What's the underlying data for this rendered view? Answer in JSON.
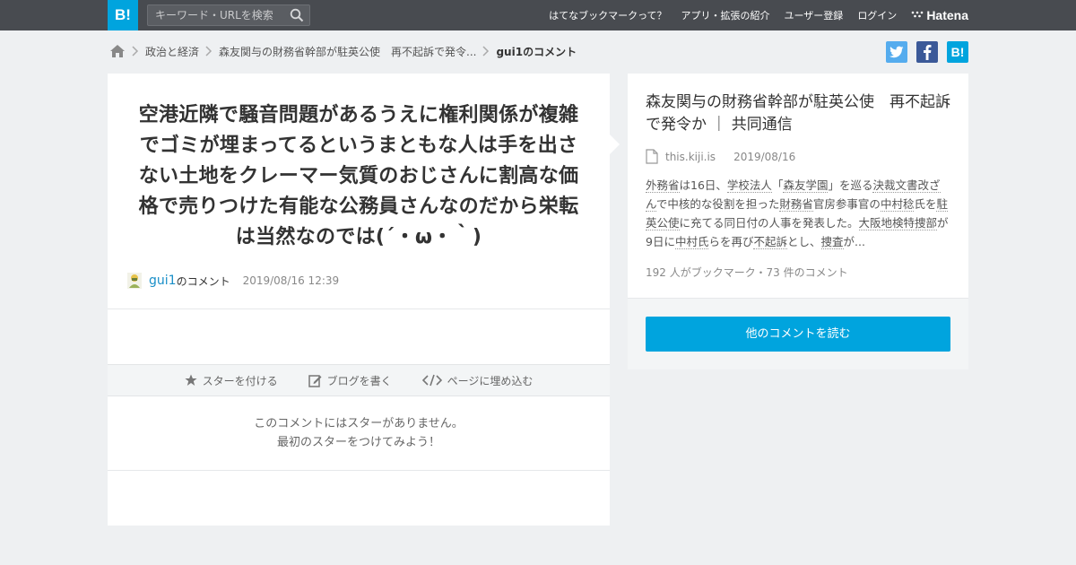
{
  "header": {
    "logo": "B!",
    "search_placeholder": "キーワード・URLを検索",
    "nav": [
      {
        "label": "はてなブックマークって？"
      },
      {
        "label": "アプリ・拡張の紹介"
      },
      {
        "label": "ユーザー登録"
      },
      {
        "label": "ログイン"
      }
    ],
    "brand": "Hatena"
  },
  "breadcrumb": {
    "items": [
      "政治と経済",
      "森友関与の財務省幹部が駐英公使　再不起訴で発令..."
    ],
    "current": "gui1のコメント"
  },
  "share": {
    "twitter": "t",
    "facebook": "f",
    "hatena": "B!"
  },
  "comment": {
    "text": "空港近隣で騒音問題があるうえに権利関係が複雑でゴミが埋まってるというまともな人は手を出さない土地をクレーマー気質のおじさんに割高な価格で売りつけた有能な公務員さんなのだから栄転は当然なのでは(´・ω・｀)",
    "user": "gui1",
    "user_suffix": "のコメント",
    "date": "2019/08/16 12:39"
  },
  "actions": {
    "star": "スターを付ける",
    "blog": "ブログを書く",
    "embed": "ページに埋め込む"
  },
  "stars": {
    "line1": "このコメントにはスターがありません。",
    "line2": "最初のスターをつけてみよう！"
  },
  "entry": {
    "title": "森友関与の財務省幹部が駐英公使　再不起訴で発令か ｜ 共同通信",
    "domain": "this.kiji.is",
    "date": "2019/08/16",
    "summary_parts": [
      {
        "text": "外務省",
        "link": true
      },
      {
        "text": "は16日、",
        "link": false
      },
      {
        "text": "学校法人",
        "link": true
      },
      {
        "text": "「",
        "link": false
      },
      {
        "text": "森友学園",
        "link": true
      },
      {
        "text": "」を巡る",
        "link": false
      },
      {
        "text": "決裁文書改ざん",
        "link": true
      },
      {
        "text": "で中核的な役割を担った",
        "link": false
      },
      {
        "text": "財務省",
        "link": true
      },
      {
        "text": "官房参事官の",
        "link": false
      },
      {
        "text": "中村稔",
        "link": true
      },
      {
        "text": "氏を",
        "link": false
      },
      {
        "text": "駐英公使",
        "link": true
      },
      {
        "text": "に充てる同日付の人事を発表した。",
        "link": false
      },
      {
        "text": "大阪地検特捜部",
        "link": true
      },
      {
        "text": "が9日に",
        "link": false
      },
      {
        "text": "中村氏",
        "link": true
      },
      {
        "text": "らを再び",
        "link": false
      },
      {
        "text": "不起訴",
        "link": true
      },
      {
        "text": "とし、",
        "link": false
      },
      {
        "text": "捜査",
        "link": true
      },
      {
        "text": "が...",
        "link": false
      }
    ],
    "stats": "192 人がブックマーク・73 件のコメント",
    "read_more": "他のコメントを読む"
  },
  "colors": {
    "accent": "#00a4de",
    "header_bg": "#484b50",
    "twitter": "#55acee",
    "facebook": "#3b5998"
  }
}
